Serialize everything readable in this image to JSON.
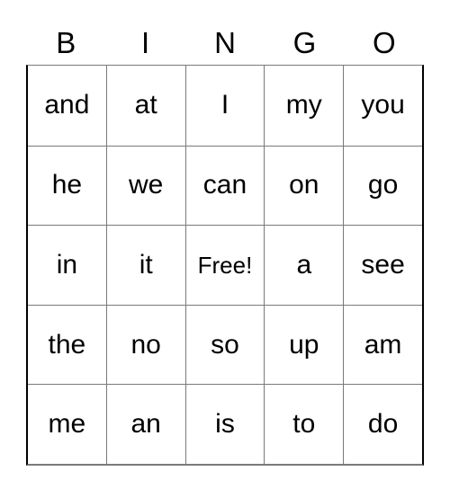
{
  "card": {
    "header_letters": [
      "B",
      "I",
      "N",
      "G",
      "O"
    ],
    "free_space_label": "Free!",
    "free_space_position": {
      "row": 2,
      "col": 2
    },
    "colors": {
      "text": "#000000",
      "background": "#ffffff",
      "outer_border": "#000000",
      "inner_grid_line": "#7a7a7a"
    },
    "grid": {
      "rows": 5,
      "cols": 5,
      "cells": [
        [
          "and",
          "at",
          "I",
          "my",
          "you"
        ],
        [
          "he",
          "we",
          "can",
          "on",
          "go"
        ],
        [
          "in",
          "it",
          "Free!",
          "a",
          "see"
        ],
        [
          "the",
          "no",
          "so",
          "up",
          "am"
        ],
        [
          "me",
          "an",
          "is",
          "to",
          "do"
        ]
      ]
    }
  }
}
